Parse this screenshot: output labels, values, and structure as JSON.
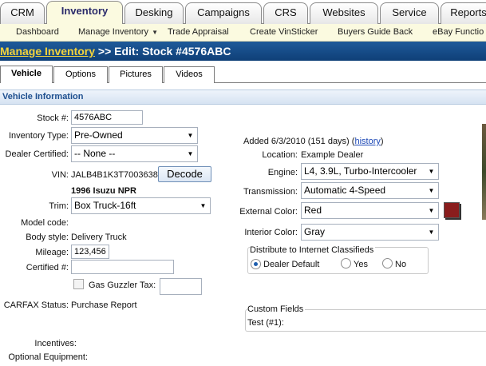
{
  "top_tabs": [
    "CRM",
    "Inventory",
    "Desking",
    "Campaigns",
    "CRS",
    "Websites",
    "Service",
    "Reports"
  ],
  "subnav": {
    "items": [
      "Dashboard",
      "Manage Inventory",
      "Trade Appraisal",
      "Create VinSticker",
      "Buyers Guide Back",
      "eBay Functio"
    ],
    "dropdown_caret": "▼"
  },
  "title": {
    "link": "Manage Inventory",
    "separator": ">>",
    "text": "Edit: Stock #4576ABC"
  },
  "subtabs": [
    "Vehicle",
    "Options",
    "Pictures",
    "Videos"
  ],
  "section_title": "Vehicle Information",
  "form": {
    "stock_label": "Stock #:",
    "stock_value": "4576ABC",
    "inventory_type_label": "Inventory Type:",
    "inventory_type_value": "Pre-Owned",
    "dealer_certified_label": "Dealer Certified:",
    "dealer_certified_value": "-- None --",
    "vin_label": "VIN:",
    "vin_value": "JALB4B1K3T7003638",
    "decode_button": "Decode",
    "vehicle_name": "1996 Isuzu NPR",
    "trim_label": "Trim:",
    "trim_value": "Box Truck-16ft",
    "model_code_label": "Model code:",
    "body_style_label": "Body style:",
    "body_style_value": "Delivery Truck",
    "mileage_label": "Mileage:",
    "mileage_value": "123,456",
    "certified_num_label": "Certified #:",
    "certified_num_value": "",
    "gas_guzzler_label": "Gas Guzzler Tax:",
    "gas_guzzler_value": "",
    "carfax_label": "CARFAX Status:",
    "carfax_value": "Purchase Report",
    "incentives_label": "Incentives:",
    "optional_equipment_label": "Optional Equipment:"
  },
  "right": {
    "added_label": "Added",
    "added_value": "6/3/2010 (151 days) (",
    "history_link": "history",
    "added_close": ")",
    "location_label": "Location:",
    "location_value": "Example Dealer",
    "engine_label": "Engine:",
    "engine_value": "L4, 3.9L, Turbo-Intercooler",
    "transmission_label": "Transmission:",
    "transmission_value": "Automatic 4-Speed",
    "external_color_label": "External Color:",
    "external_color_value": "Red",
    "external_color_hex": "#8a1d1d",
    "interior_color_label": "Interior Color:",
    "interior_color_value": "Gray",
    "distribute_label": "Distribute to Internet Classifieds",
    "distribute_options": [
      "Dealer Default",
      "Yes",
      "No"
    ],
    "custom_fields_label": "Custom Fields",
    "custom_test_label": "Test (#1):"
  },
  "colors": {
    "accent_blue": "#0f3f77",
    "link_yellow": "#f3d33c",
    "subnav_bg": "#fbfae0",
    "section_text": "#1e4f8f"
  }
}
